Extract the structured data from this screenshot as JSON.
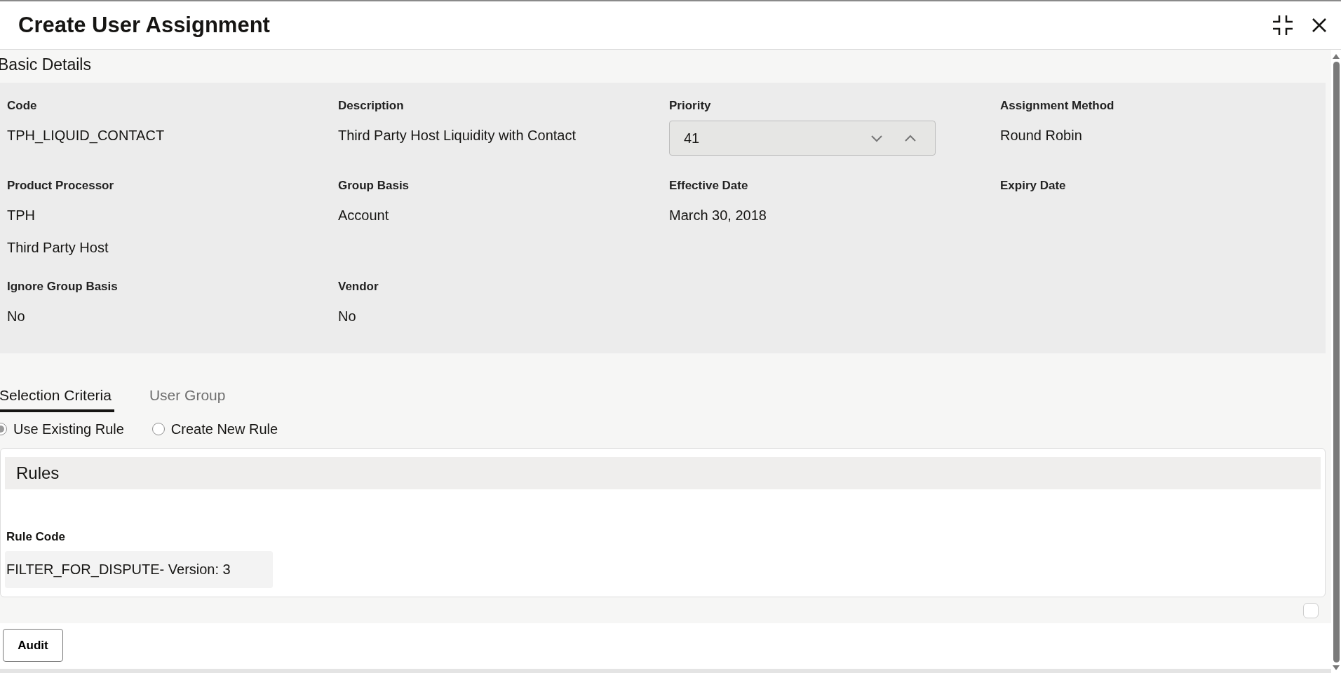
{
  "dialog": {
    "title": "Create User Assignment"
  },
  "basic_details": {
    "title": "Basic Details",
    "fields": [
      {
        "label": "Code",
        "kind": "text",
        "values": [
          "TPH_LIQUID_CONTACT"
        ]
      },
      {
        "label": "Description",
        "kind": "text",
        "values": [
          "Third Party Host Liquidity with Contact"
        ]
      },
      {
        "label": "Priority",
        "kind": "stepper",
        "values": [
          "41"
        ]
      },
      {
        "label": "Assignment Method",
        "kind": "text",
        "values": [
          "Round Robin"
        ]
      },
      {
        "label": "Product Processor",
        "kind": "text",
        "values": [
          "TPH",
          "Third Party Host"
        ]
      },
      {
        "label": "Group Basis",
        "kind": "text",
        "values": [
          "Account"
        ]
      },
      {
        "label": "Effective Date",
        "kind": "text",
        "values": [
          "March 30, 2018"
        ]
      },
      {
        "label": "Expiry Date",
        "kind": "text"
      },
      {
        "label": "Ignore Group Basis",
        "kind": "text",
        "values": [
          "No"
        ]
      },
      {
        "label": "Vendor",
        "kind": "text",
        "values": [
          "No"
        ]
      }
    ]
  },
  "tabs": [
    {
      "label": "Selection Criteria",
      "selected": true
    },
    {
      "label": "User Group",
      "selected": false
    }
  ],
  "rule_options": [
    {
      "label": "Use Existing Rule",
      "selected": true
    },
    {
      "label": "Create New Rule",
      "selected": false
    }
  ],
  "rules": {
    "title": "Rules",
    "field_label": "Rule Code",
    "field_value": "FILTER_FOR_DISPUTE- Version: 3"
  },
  "buttons": [
    "Audit"
  ]
}
